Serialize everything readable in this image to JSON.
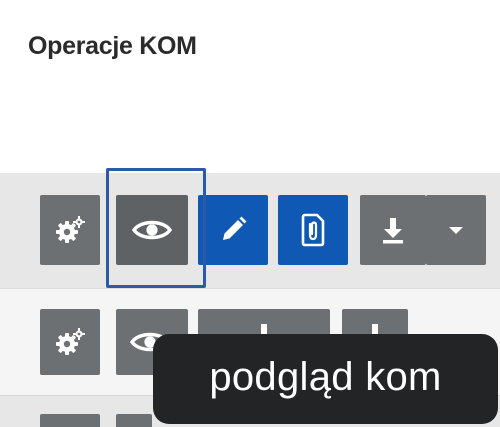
{
  "panel": {
    "title": "Operacje KOM"
  },
  "rows": [
    {
      "actions": [
        {
          "name": "settings",
          "icon": "gears-icon"
        },
        {
          "name": "view",
          "icon": "eye-icon",
          "focused": true
        },
        {
          "name": "edit",
          "icon": "pencil-icon"
        },
        {
          "name": "attachment",
          "icon": "paperclip-file-icon"
        },
        {
          "name": "download",
          "icon": "download-icon"
        },
        {
          "name": "more",
          "icon": "caret-down-icon"
        }
      ]
    },
    {
      "actions": [
        {
          "name": "settings",
          "icon": "gears-icon"
        },
        {
          "name": "view",
          "icon": "eye-icon"
        },
        {
          "name": "download",
          "icon": "download-icon"
        },
        {
          "name": "download-2",
          "icon": "download-icon"
        }
      ]
    }
  ],
  "tooltip": {
    "text": "podgląd kom"
  },
  "colors": {
    "gray_button": "#6c7073",
    "dark_button": "#5e6265",
    "blue_button": "#0f58b3",
    "focus_outline": "#2c5aa8",
    "tooltip_bg": "#222426"
  }
}
